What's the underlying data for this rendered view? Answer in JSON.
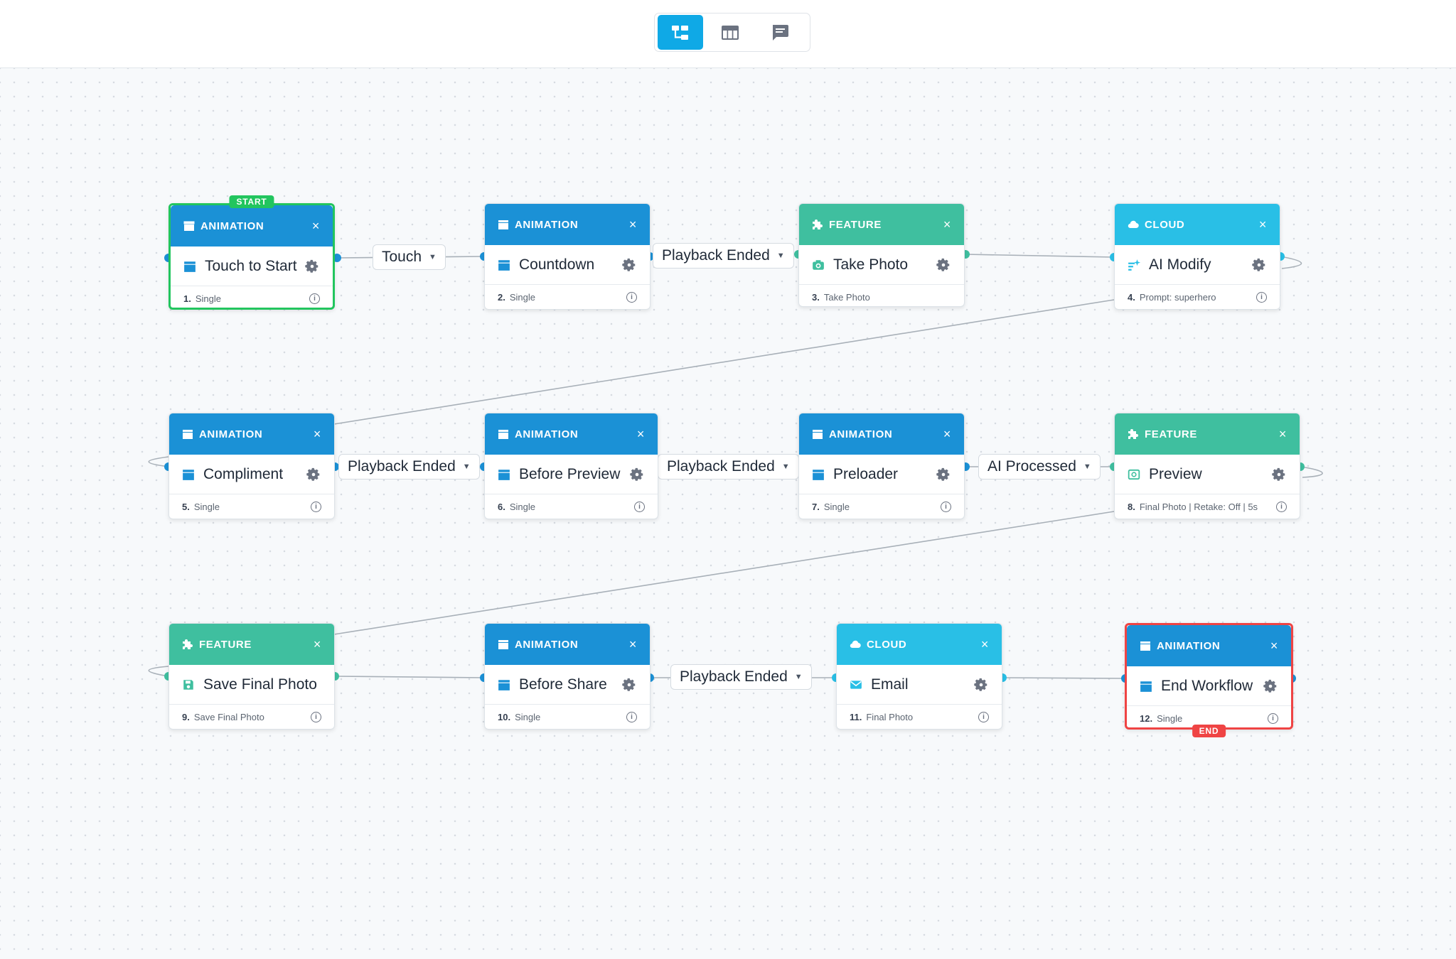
{
  "toolbar": {
    "views": [
      {
        "name": "flow-view",
        "icon": "flow-diagram-icon",
        "active": true
      },
      {
        "name": "table-view",
        "icon": "table-icon",
        "active": false
      },
      {
        "name": "chat-view",
        "icon": "chat-icon",
        "active": false
      }
    ]
  },
  "colors": {
    "animation": "#1b91d6",
    "feature": "#3fbf9f",
    "cloud": "#29bfe6",
    "start": "#22c55e",
    "end": "#ef4444",
    "port": "#1b91d6",
    "port_alt": "#3fbf9f"
  },
  "badges": {
    "start": "START",
    "end": "END"
  },
  "nodes": [
    {
      "type_label": "ANIMATION",
      "label": "Touch to Start",
      "number": "1.",
      "meta": "Single",
      "icon": "clapperboard-icon",
      "close": "×"
    },
    {
      "type_label": "ANIMATION",
      "label": "Countdown",
      "number": "2.",
      "meta": "Single",
      "icon": "clapperboard-icon",
      "close": "×"
    },
    {
      "type_label": "FEATURE",
      "label": "Take Photo",
      "number": "3.",
      "meta": "Take Photo",
      "icon": "camera-icon",
      "close": "×"
    },
    {
      "type_label": "CLOUD",
      "label": "AI Modify",
      "number": "4.",
      "meta": "Prompt: superhero",
      "icon": "magic-icon",
      "close": "×"
    },
    {
      "type_label": "ANIMATION",
      "label": "Compliment",
      "number": "5.",
      "meta": "Single",
      "icon": "clapperboard-icon",
      "close": "×"
    },
    {
      "type_label": "ANIMATION",
      "label": "Before Preview",
      "number": "6.",
      "meta": "Single",
      "icon": "clapperboard-icon",
      "close": "×"
    },
    {
      "type_label": "ANIMATION",
      "label": "Preloader",
      "number": "7.",
      "meta": "Single",
      "icon": "clapperboard-icon",
      "close": "×"
    },
    {
      "type_label": "FEATURE",
      "label": "Preview",
      "number": "8.",
      "meta": "Final Photo | Retake: Off | 5s",
      "icon": "preview-icon",
      "close": "×"
    },
    {
      "type_label": "FEATURE",
      "label": "Save Final Photo",
      "number": "9.",
      "meta": "Save Final Photo",
      "icon": "save-icon",
      "close": "×"
    },
    {
      "type_label": "ANIMATION",
      "label": "Before Share",
      "number": "10.",
      "meta": "Single",
      "icon": "clapperboard-icon",
      "close": "×"
    },
    {
      "type_label": "CLOUD",
      "label": "Email",
      "number": "11.",
      "meta": "Final Photo",
      "icon": "email-icon",
      "close": "×"
    },
    {
      "type_label": "ANIMATION",
      "label": "End Workflow",
      "number": "12.",
      "meta": "Single",
      "icon": "clapperboard-icon",
      "close": "×"
    }
  ],
  "triggers": [
    {
      "label": "Touch"
    },
    {
      "label": "Playback Ended"
    },
    {
      "label": "Playback Ended"
    },
    {
      "label": "Playback Ended"
    },
    {
      "label": "AI Processed"
    },
    {
      "label": "Playback Ended"
    }
  ]
}
